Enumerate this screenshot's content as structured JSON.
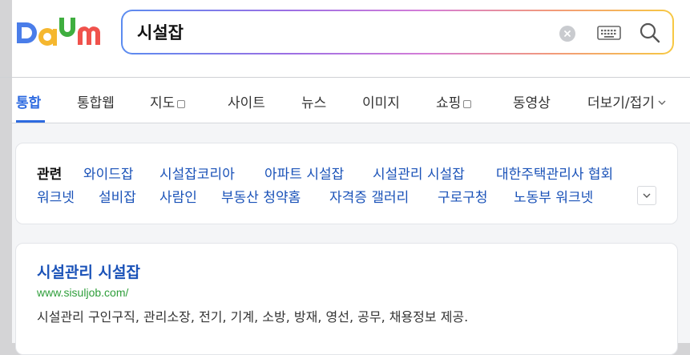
{
  "logo": {
    "text": "Daum"
  },
  "search": {
    "query": "시설잡"
  },
  "tabs": [
    {
      "label": "통합"
    },
    {
      "label": "통합웹"
    },
    {
      "label": "지도"
    },
    {
      "label": "사이트"
    },
    {
      "label": "뉴스"
    },
    {
      "label": "이미지"
    },
    {
      "label": "쇼핑"
    },
    {
      "label": "동영상"
    },
    {
      "label": "더보기/접기"
    }
  ],
  "related": {
    "title": "관련",
    "links": [
      "와이드잡",
      "시설잡코리아",
      "아파트 시설잡",
      "시설관리 시설잡",
      "대한주택관리사 협회",
      "워크넷",
      "설비잡",
      "사람인",
      "부동산 청약홈",
      "자격증 갤러리",
      "구로구청",
      "노동부 워크넷"
    ]
  },
  "result": {
    "title": "시설관리 시설잡",
    "url": "www.sisuljob.com/",
    "description": "시설관리 구인구직, 관리소장, 전기, 기계, 소방, 방재, 영선, 공무, 채용정보 제공."
  },
  "colors": {
    "accent": "#2d6ae0",
    "link": "#1a52b8",
    "url": "#2e9e3a"
  }
}
